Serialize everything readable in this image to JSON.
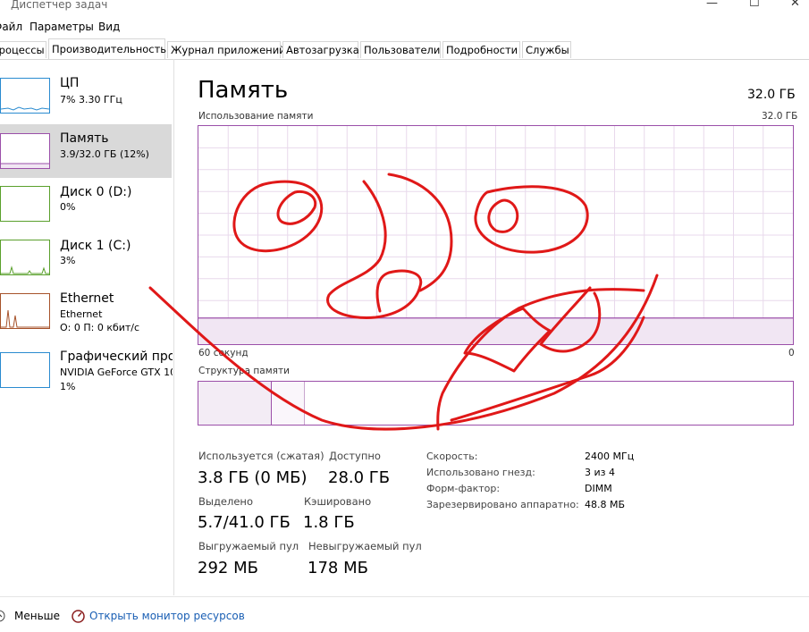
{
  "app": {
    "title": "Диспетчер задач"
  },
  "menu": [
    "Файл",
    "Параметры",
    "Вид"
  ],
  "tabs": [
    "Процессы",
    "Производительность",
    "Журнал приложений",
    "Автозагрузка",
    "Пользователи",
    "Подробности",
    "Службы"
  ],
  "active_tab": "Производительность",
  "sidebar": [
    {
      "name": "ЦП",
      "sub1": "7%  3.30 ГГц",
      "sub2": "",
      "sub3": ""
    },
    {
      "name": "Память",
      "sub1": "3.9/32.0 ГБ (12%)",
      "sub2": "",
      "sub3": ""
    },
    {
      "name": "Диск 0 (D:)",
      "sub1": "0%",
      "sub2": "",
      "sub3": ""
    },
    {
      "name": "Диск 1 (C:)",
      "sub1": "3%",
      "sub2": "",
      "sub3": ""
    },
    {
      "name": "Ethernet",
      "sub1": "Ethernet",
      "sub2": "О: 0 П: 0 кбит/с",
      "sub3": ""
    },
    {
      "name": "Графический про",
      "sub1": "NVIDIA GeForce GTX 10",
      "sub2": "1%",
      "sub3": ""
    }
  ],
  "main": {
    "title": "Память",
    "total": "32.0 ГБ",
    "usage_label": "Использование памяти",
    "usage_max": "32.0 ГБ",
    "time_left": "60 секунд",
    "time_right": "0",
    "composition_label": "Структура памяти",
    "usage_fraction": 0.12
  },
  "stats": {
    "in_use_label": "Используется (сжатая)",
    "in_use_value": "3.8 ГБ (0 МБ)",
    "available_label": "Доступно",
    "available_value": "28.0 ГБ",
    "committed_label": "Выделено",
    "committed_value": "5.7/41.0 ГБ",
    "cached_label": "Кэшировано",
    "cached_value": "1.8 ГБ",
    "paged_label": "Выгружаемый пул",
    "paged_value": "292 МБ",
    "nonpaged_label": "Невыгружаемый пул",
    "nonpaged_value": "178 МБ"
  },
  "info": [
    {
      "label": "Скорость:",
      "value": "2400 МГц"
    },
    {
      "label": "Использовано гнезд:",
      "value": "3 из 4"
    },
    {
      "label": "Форм-фактор:",
      "value": "DIMM"
    },
    {
      "label": "Зарезервировано аппаратно:",
      "value": "48.8 МБ"
    }
  ],
  "bottom": {
    "less_label": "Меньше",
    "monitor_label": "Открыть монитор ресурсов"
  },
  "colors": {
    "memory_accent": "#9b4fa9",
    "cpu_accent": "#2a8bd0",
    "disk_accent": "#5aa02c",
    "net_accent": "#a6522a",
    "scribble": "#e01818"
  }
}
